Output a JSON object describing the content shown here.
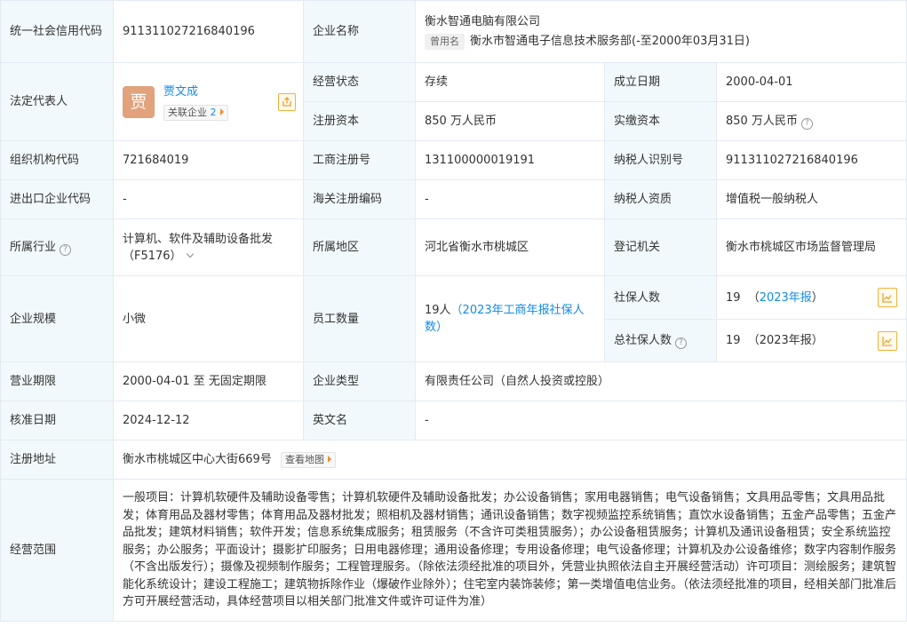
{
  "labels": {
    "credit_code": "统一社会信用代码",
    "company_name": "企业名称",
    "legal_rep": "法定代表人",
    "status": "经营状态",
    "founded": "成立日期",
    "reg_capital": "注册资本",
    "paid_capital": "实缴资本",
    "org_code": "组织机构代码",
    "biz_reg_no": "工商注册号",
    "taxpayer_id": "纳税人识别号",
    "import_export_code": "进出口企业代码",
    "customs_code": "海关注册编码",
    "taxpayer_qual": "纳税人资质",
    "industry": "所属行业",
    "region": "所属地区",
    "reg_authority": "登记机关",
    "scale": "企业规模",
    "employees": "员工数量",
    "social_insured": "社保人数",
    "total_social_insured": "总社保人数",
    "biz_term": "营业期限",
    "company_type": "企业类型",
    "approval_date": "核准日期",
    "english_name": "英文名",
    "reg_address": "注册地址",
    "biz_scope": "经营范围"
  },
  "values": {
    "credit_code": "911311027216840196",
    "company_name": "衡水智通电脑有限公司",
    "former_name_tag": "曾用名",
    "former_name": "衡水市智通电子信息技术服务部(-至2000年03月31日)",
    "legal_rep_avatar": "贾",
    "legal_rep_name": "贾文成",
    "related_companies_label": "关联企业",
    "related_companies_count": "2",
    "status": "存续",
    "founded": "2000-04-01",
    "reg_capital": "850 万人民币",
    "paid_capital": "850 万人民币",
    "org_code": "721684019",
    "biz_reg_no": "131100000019191",
    "taxpayer_id": "911311027216840196",
    "import_export_code": "-",
    "customs_code": "-",
    "taxpayer_qual": "增值税一般纳税人",
    "industry": "计算机、软件及辅助设备批发（F5176）",
    "region": "河北省衡水市桃城区",
    "reg_authority": "衡水市桃城区市场监督管理局",
    "scale": "小微",
    "employees_count": "19人",
    "employees_note": "（2023年工商年报社保人数）",
    "social_insured_count": "19",
    "social_insured_note_open": "（",
    "social_insured_note": "2023年报",
    "social_insured_note_close": "）",
    "total_social_insured_count": "19",
    "total_social_insured_note": "（2023年报）",
    "biz_term": "2000-04-01 至 无固定期限",
    "company_type": "有限责任公司（自然人投资或控股）",
    "approval_date": "2024-12-12",
    "english_name": "-",
    "reg_address": "衡水市桃城区中心大街669号",
    "view_map": "查看地图",
    "biz_scope": "一般项目：计算机软硬件及辅助设备零售；计算机软硬件及辅助设备批发；办公设备销售；家用电器销售；电气设备销售；文具用品零售；文具用品批发；体育用品及器材零售；体育用品及器材批发；照相机及器材销售；通讯设备销售；数字视频监控系统销售；直饮水设备销售；五金产品零售；五金产品批发；建筑材料销售；软件开发；信息系统集成服务；租赁服务（不含许可类租赁服务）；办公设备租赁服务；计算机及通讯设备租赁；安全系统监控服务；办公服务；平面设计；摄影扩印服务；日用电器修理；通用设备修理；专用设备修理；电气设备修理；计算机及办公设备维修；数字内容制作服务（不含出版发行）；摄像及视频制作服务；工程管理服务。（除依法须经批准的项目外，凭营业执照依法自主开展经营活动）许可项目：测绘服务；建筑智能化系统设计；建设工程施工；建筑物拆除作业（爆破作业除外）；住宅室内装饰装修；第一类增值电信业务。（依法须经批准的项目，经相关部门批准后方可开展经营活动，具体经营项目以相关部门批准文件或许可证件为准）"
  },
  "icons": {
    "help": "question-circle-icon",
    "share": "share-export-icon",
    "chart": "line-chart-icon",
    "chevron": "chevron-down-icon",
    "arrow": "caret-right-icon"
  },
  "colors": {
    "label_bg": "#f2f9fc",
    "border": "#e4eaf2",
    "link": "#128bed",
    "avatar": "#e1a27c",
    "icon_accent": "#f0b23a"
  }
}
